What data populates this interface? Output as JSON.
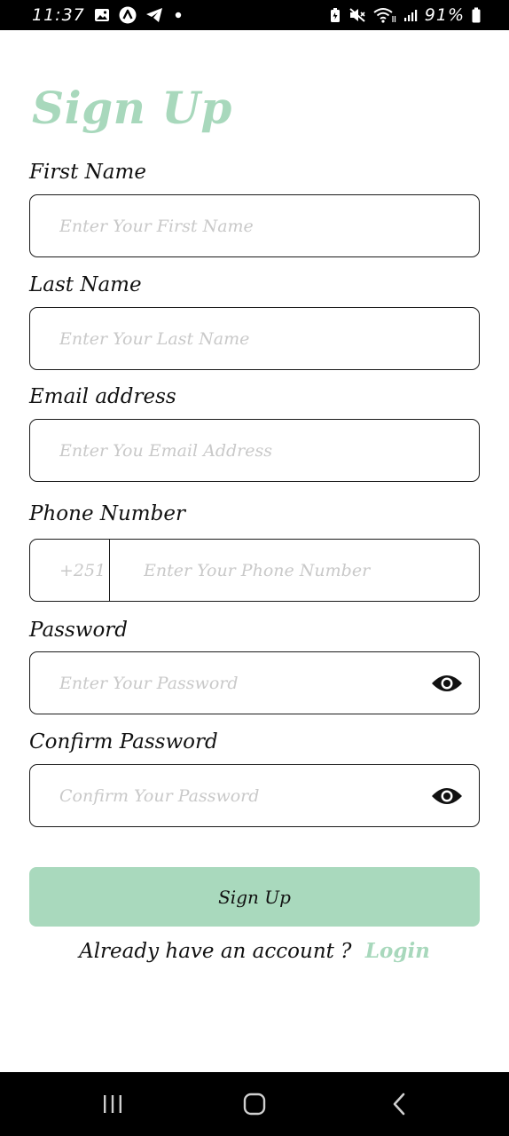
{
  "status_bar": {
    "time": "11:37",
    "battery": "91%",
    "icons": [
      "image-icon",
      "app-icon",
      "telegram-icon",
      "dot-icon",
      "battery-saver-icon",
      "mute-icon",
      "wifi-icon",
      "signal-icon",
      "battery-icon"
    ]
  },
  "title": "Sign Up",
  "fields": {
    "first_name": {
      "label": "First Name",
      "placeholder": "Enter Your First Name"
    },
    "last_name": {
      "label": "Last Name",
      "placeholder": "Enter Your Last Name"
    },
    "email": {
      "label": "Email address",
      "placeholder": "Enter You Email Address"
    },
    "phone": {
      "label": "Phone Number",
      "prefix": "+251",
      "placeholder": "Enter Your Phone Number"
    },
    "password": {
      "label": "Password",
      "placeholder": "Enter Your Password",
      "icon": "eye-icon"
    },
    "confirm_password": {
      "label": "Confirm Password",
      "placeholder": "Confirm Your Password",
      "icon": "eye-icon"
    }
  },
  "signup_button": "Sign Up",
  "login_prompt": "Already have an account ?",
  "login_link": "Login",
  "colors": {
    "accent": "#a8d8bc",
    "button_bg": "#a9d9bd",
    "placeholder": "#c9c9c9",
    "text": "#111111"
  },
  "nav_bar": {
    "icons": [
      "recent-apps-icon",
      "home-icon",
      "back-icon"
    ]
  }
}
